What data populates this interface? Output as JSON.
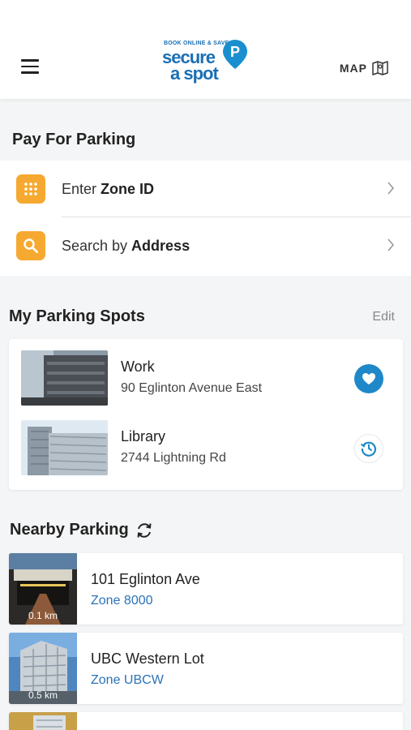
{
  "header": {
    "logo": {
      "tagline": "BOOK ONLINE & SAVE",
      "line1": "secure",
      "line2": "a spot",
      "pin_letter": "P"
    },
    "map_label": "MAP"
  },
  "pay": {
    "title": "Pay For Parking",
    "zone_prefix": "Enter ",
    "zone_bold": "Zone ID",
    "search_prefix": "Search by ",
    "search_bold": "Address"
  },
  "spots": {
    "title": "My Parking Spots",
    "edit_label": "Edit",
    "items": [
      {
        "name": "Work",
        "address": "90 Eglinton Avenue East",
        "action_icon": "heart-icon"
      },
      {
        "name": "Library",
        "address": "2744 Lightning Rd",
        "action_icon": "history-icon"
      }
    ]
  },
  "nearby": {
    "title": "Nearby Parking",
    "items": [
      {
        "name": "101 Eglinton Ave",
        "zone": "Zone 8000",
        "distance": "0.1 km"
      },
      {
        "name": "UBC Western Lot",
        "zone": "Zone UBCW",
        "distance": "0.5 km"
      }
    ]
  },
  "colors": {
    "brand_blue": "#1a6fb4",
    "accent_orange": "#f6a930",
    "icon_blue": "#1e88c9",
    "link_blue": "#2a73b8"
  }
}
